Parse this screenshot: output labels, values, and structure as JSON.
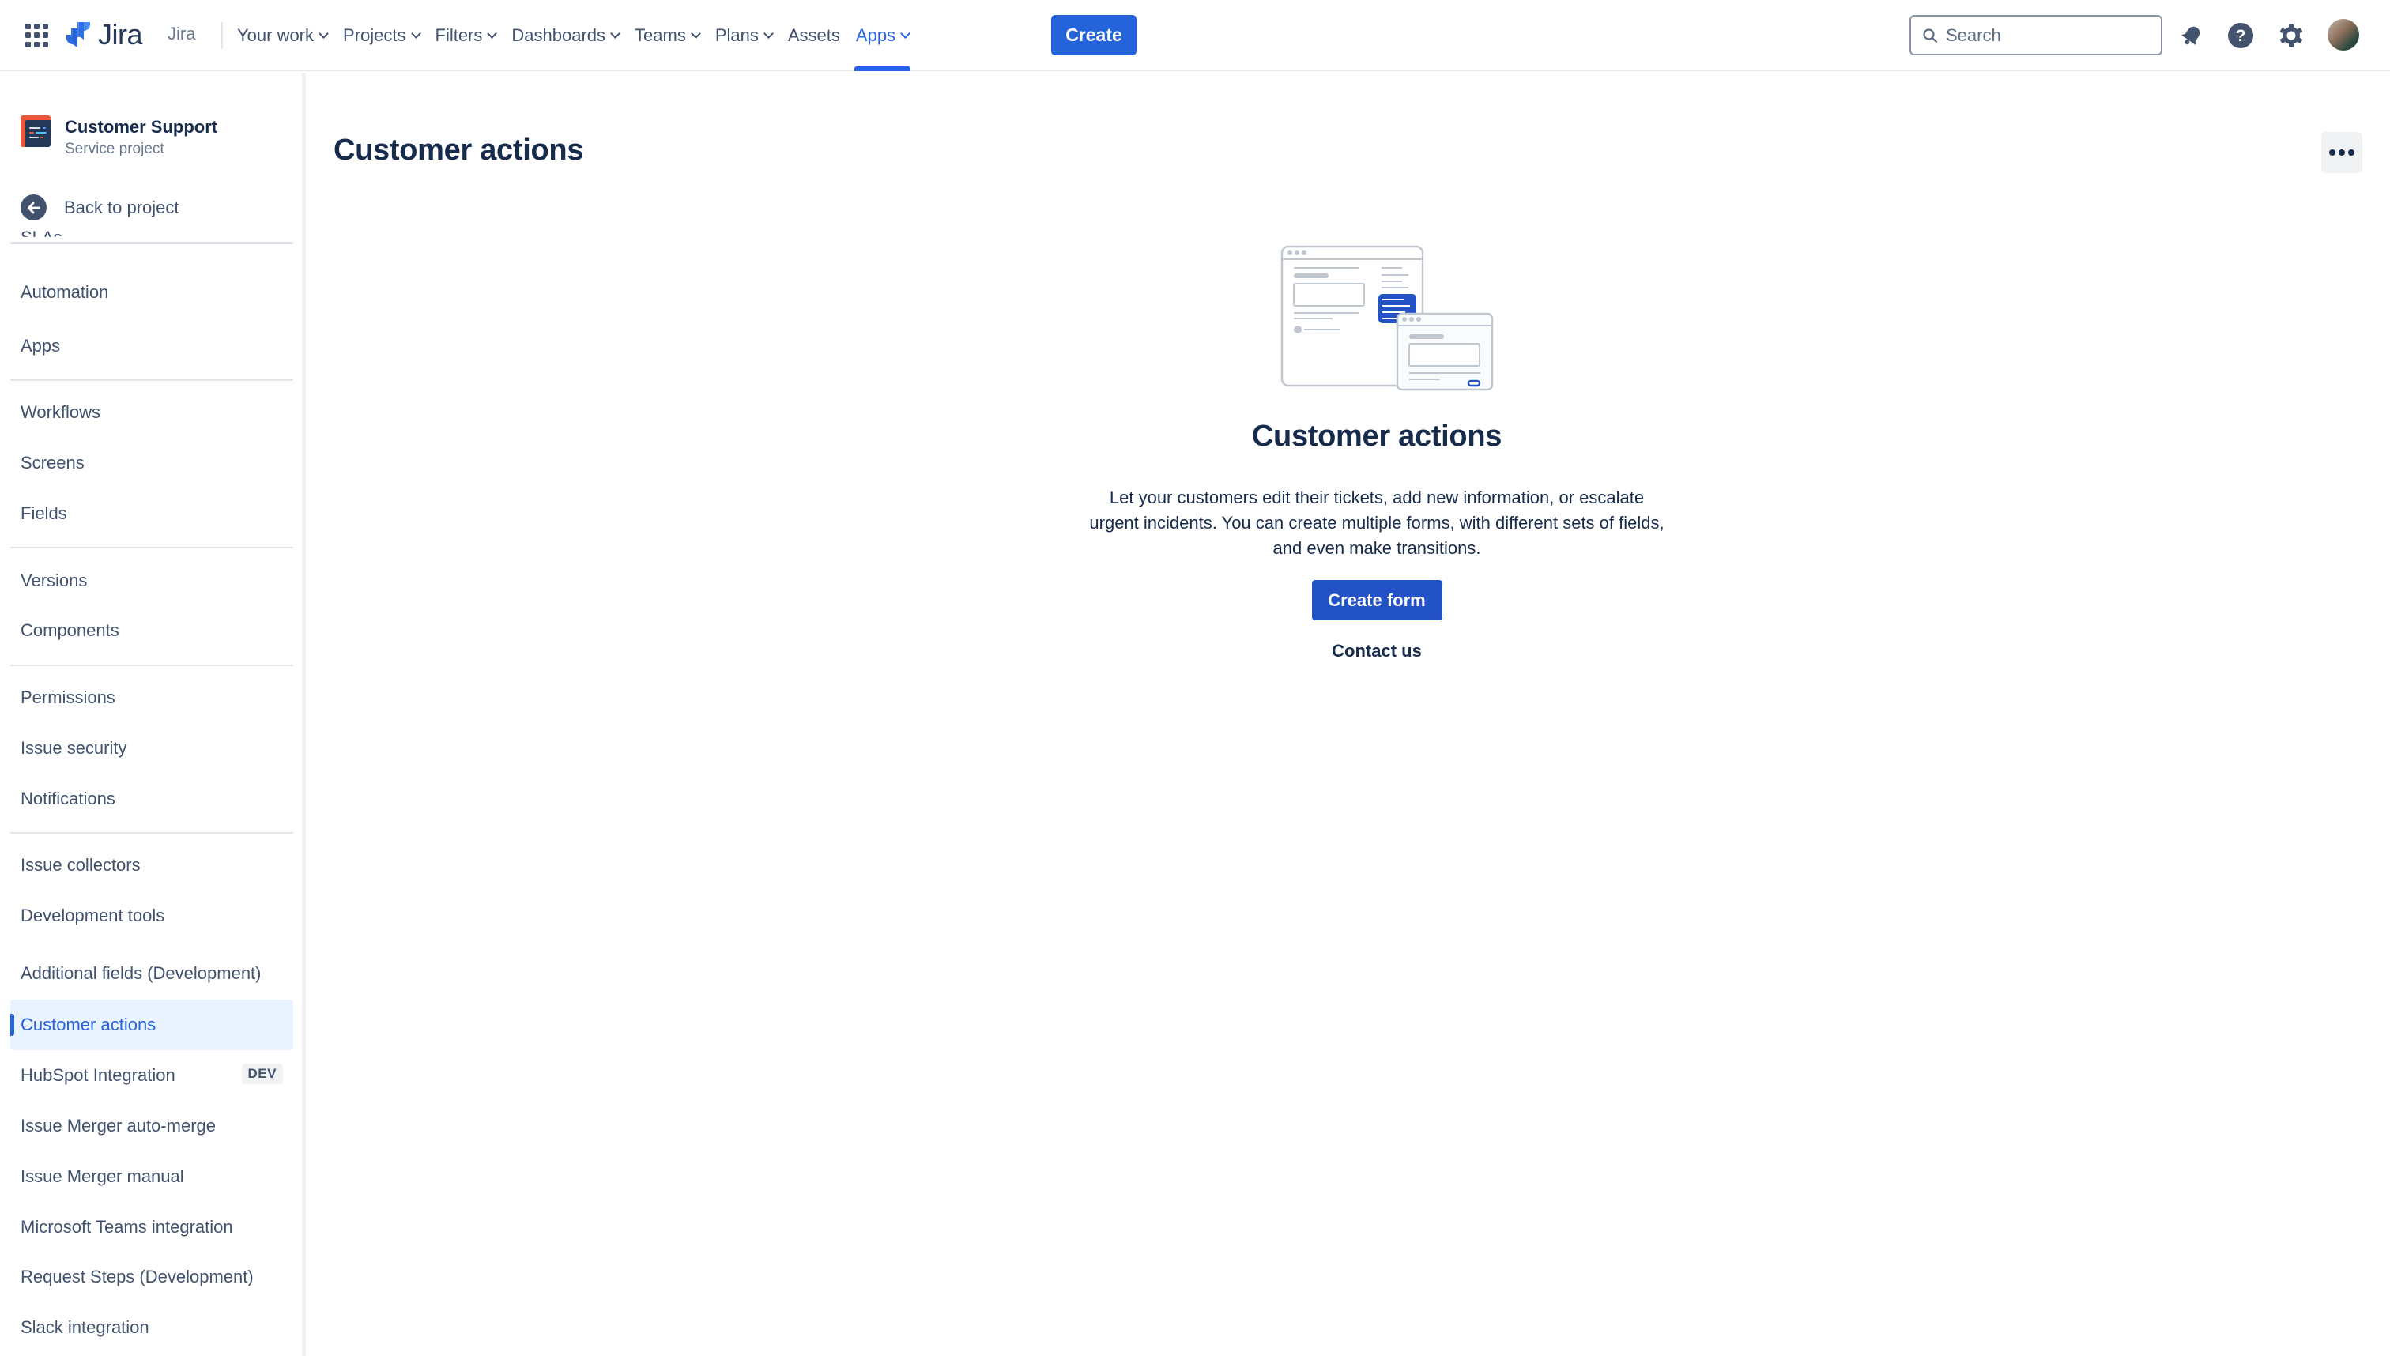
{
  "topnav": {
    "logo_text": "Jira",
    "product_label": "Jira",
    "items": [
      {
        "label": "Your work",
        "dropdown": true,
        "active": false
      },
      {
        "label": "Projects",
        "dropdown": true,
        "active": false
      },
      {
        "label": "Filters",
        "dropdown": true,
        "active": false
      },
      {
        "label": "Dashboards",
        "dropdown": true,
        "active": false
      },
      {
        "label": "Teams",
        "dropdown": true,
        "active": false
      },
      {
        "label": "Plans",
        "dropdown": true,
        "active": false
      },
      {
        "label": "Assets",
        "dropdown": false,
        "active": false
      },
      {
        "label": "Apps",
        "dropdown": true,
        "active": true
      }
    ],
    "create_label": "Create",
    "search_placeholder": "Search",
    "icons": [
      "notifications-icon",
      "help-icon",
      "settings-icon",
      "avatar"
    ]
  },
  "sidebar": {
    "project_name": "Customer Support",
    "project_type": "Service project",
    "back_label": "Back to project",
    "partially_hidden_item": "SLAs",
    "items": [
      {
        "label": "Automation"
      },
      {
        "label": "Apps"
      },
      {
        "label": "Workflows"
      },
      {
        "label": "Screens"
      },
      {
        "label": "Fields"
      },
      {
        "label": "Versions"
      },
      {
        "label": "Components"
      },
      {
        "label": "Permissions"
      },
      {
        "label": "Issue security"
      },
      {
        "label": "Notifications"
      },
      {
        "label": "Issue collectors"
      },
      {
        "label": "Development tools"
      },
      {
        "label": "Additional fields (Development)"
      },
      {
        "label": "Customer actions",
        "selected": true
      },
      {
        "label": "HubSpot Integration",
        "badge": "DEV"
      },
      {
        "label": "Issue Merger auto-merge"
      },
      {
        "label": "Issue Merger manual"
      },
      {
        "label": "Microsoft Teams integration"
      },
      {
        "label": "Request Steps (Development)"
      },
      {
        "label": "Slack integration"
      }
    ]
  },
  "main": {
    "page_title": "Customer actions",
    "more_actions_icon": "more-icon",
    "empty_state": {
      "title": "Customer actions",
      "description": "Let your customers edit their tickets, add new information, or escalate urgent incidents. You can create multiple forms, with different sets of fields, and even make transitions.",
      "primary_button": "Create form",
      "secondary_link": "Contact us"
    }
  },
  "colors": {
    "brand_blue": "#2563db",
    "primary_button": "#2252c6",
    "text_primary": "#172b4d",
    "text_secondary": "#42526e",
    "selected_bg": "#e9f2ff",
    "project_avatar": "#e8593b"
  }
}
